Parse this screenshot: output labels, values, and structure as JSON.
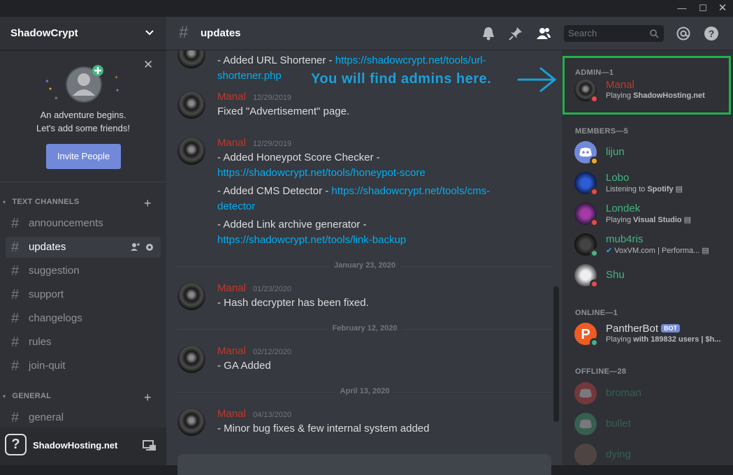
{
  "window": {
    "minimize": "—",
    "maximize": "☐",
    "close": "✕"
  },
  "server": {
    "name": "ShadowCrypt"
  },
  "welcome": {
    "line1": "An adventure begins.",
    "line2": "Let's add some friends!",
    "invite_label": "Invite People"
  },
  "categories": {
    "text": "TEXT CHANNELS",
    "general": "GENERAL"
  },
  "channels": [
    {
      "name": "announcements"
    },
    {
      "name": "updates"
    },
    {
      "name": "suggestion"
    },
    {
      "name": "support"
    },
    {
      "name": "changelogs"
    },
    {
      "name": "rules"
    },
    {
      "name": "join-quit"
    }
  ],
  "general_channels": [
    {
      "name": "general"
    }
  ],
  "user_panel": {
    "name": "ShadowHosting.net",
    "avatar_glyph": "?"
  },
  "header": {
    "channel": "updates",
    "search_placeholder": "Search"
  },
  "messages": {
    "m0": {
      "line1_text": "- Added URL Shortener - ",
      "line1_link": "https://shadowcrypt.net/tools/url-",
      "line2_link": "shortener.php"
    },
    "m1": {
      "author": "Manal",
      "time": "12/29/2019",
      "text": "Fixed \"Advertisement\" page."
    },
    "m2": {
      "author": "Manal",
      "time": "12/29/2019",
      "l1": "- Added Honeypot Score Checker -",
      "l2": "https://shadowcrypt.net/tools/honeypot-score",
      "l3_text": "- Added CMS Detector - ",
      "l3_link": "https://shadowcrypt.net/tools/cms-",
      "l4": "detector",
      "l5": "- Added Link archive generator -",
      "l6": "https://shadowcrypt.net/tools/link-backup"
    },
    "d1": "January 23, 2020",
    "m3": {
      "author": "Manal",
      "time": "01/23/2020",
      "text": "- Hash decrypter has been fixed."
    },
    "d2": "February 12, 2020",
    "m4": {
      "author": "Manal",
      "time": "02/12/2020",
      "text": "- GA Added"
    },
    "d3": "April 13, 2020",
    "m5": {
      "author": "Manal",
      "time": "04/13/2020",
      "text": "- Minor bug fixes & few internal system added"
    }
  },
  "annotation": "You will find admins here.",
  "member_list": {
    "admin_header": "ADMIN—1",
    "members_header": "MEMBERS—5",
    "online_header": "ONLINE—1",
    "offline_header": "OFFLINE—28",
    "admin": {
      "name": "Manal",
      "act_prefix": "Playing ",
      "act_bold": "ShadowHosting.net",
      "color": "#c0392b"
    },
    "members": [
      {
        "name": "lijun",
        "act_prefix": "",
        "act_bold": ""
      },
      {
        "name": "Lobo",
        "act_prefix": "Listening to ",
        "act_bold": "Spotify"
      },
      {
        "name": "Londek",
        "act_prefix": "Playing ",
        "act_bold": "Visual Studio"
      },
      {
        "name": "mub4ris",
        "act_prefix": "VoxVM.com | Performa...",
        "act_bold": ""
      },
      {
        "name": "Shu",
        "act_prefix": "",
        "act_bold": ""
      }
    ],
    "online": {
      "name": "PantherBot",
      "badge": "BOT",
      "act_prefix": "Playing ",
      "act_bold": "with 189832 users | $h..."
    },
    "offline": [
      {
        "name": "broman"
      },
      {
        "name": "bullet"
      },
      {
        "name": "dying"
      }
    ]
  },
  "colors": {
    "accent": "#7289da",
    "link": "#00aff4",
    "admin": "#c0392b",
    "member": "#43b581",
    "highlight": "#22b14c"
  }
}
